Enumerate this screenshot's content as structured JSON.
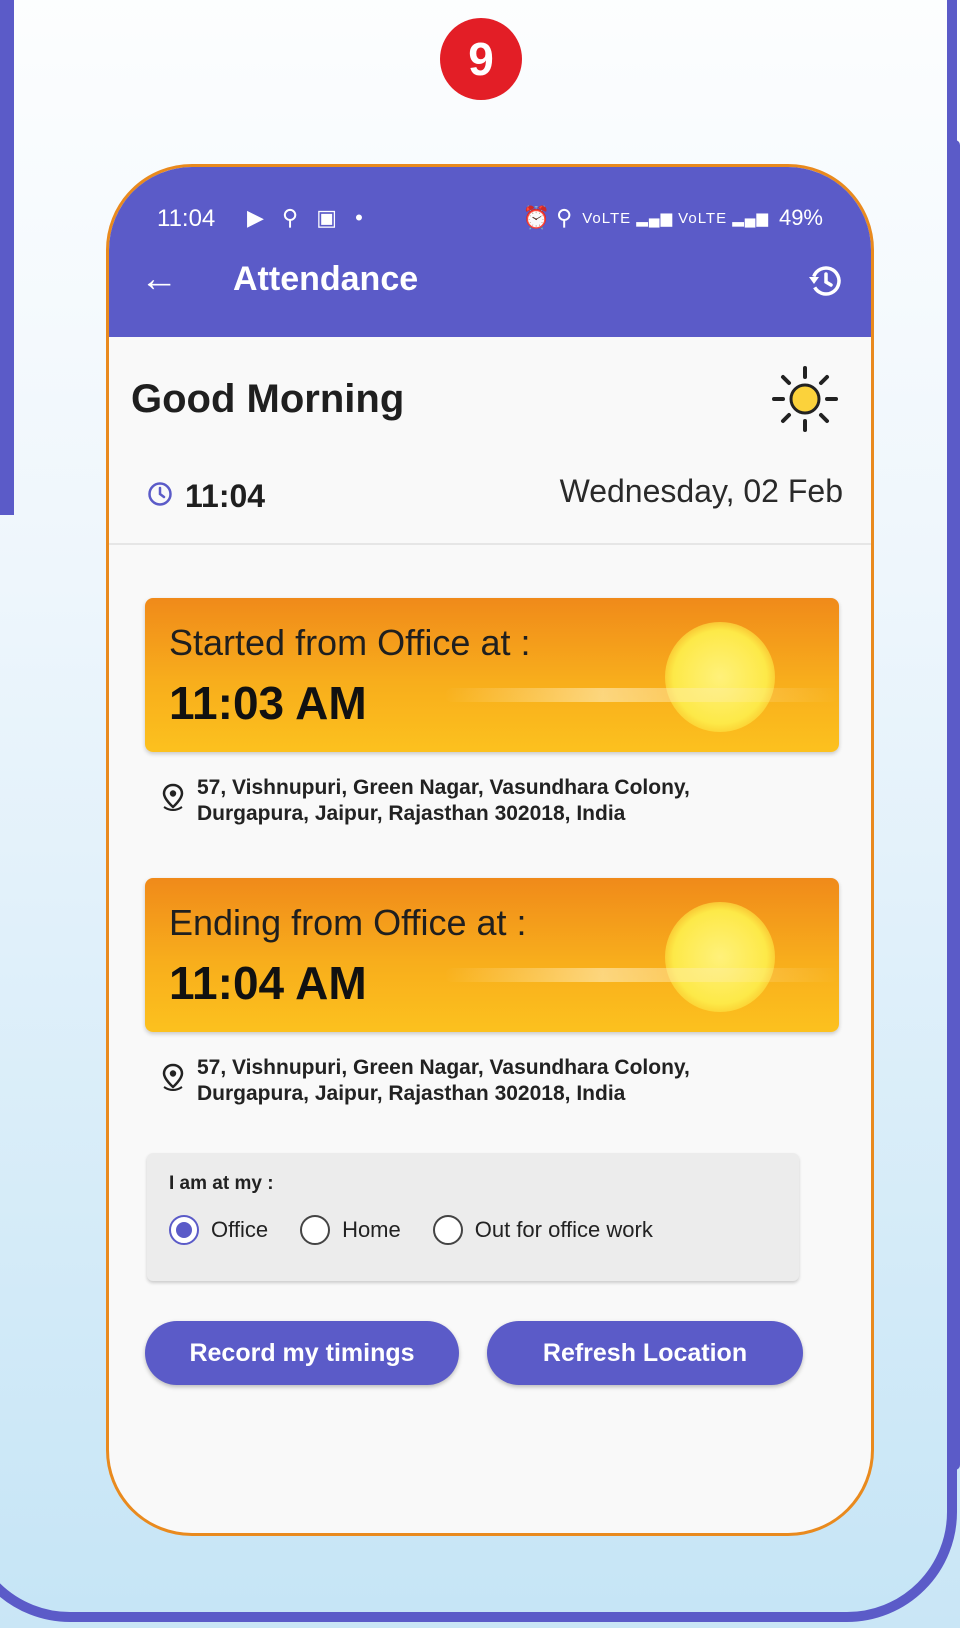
{
  "step_badge": "9",
  "status_bar": {
    "time": "11:04",
    "left_icons": "▶ ⚲ ▣ •",
    "right_icons": "⏰ ⚲",
    "signal": "VoLTE ▂▄▆ VoLTE ▂▄▆",
    "battery": "49%"
  },
  "appbar": {
    "title": "Attendance",
    "back_icon": "arrow-left-icon",
    "history_icon": "history-icon"
  },
  "greeting": {
    "text": "Good Morning",
    "weather_icon": "sun-icon"
  },
  "clock": {
    "time": "11:04",
    "date": "Wednesday, 02 Feb"
  },
  "start_card": {
    "label": "Started from Office at :",
    "time": "11:03 AM",
    "address": "57, Vishnupuri, Green Nagar, Vasundhara Colony, Durgapura, Jaipur, Rajasthan 302018, India"
  },
  "end_card": {
    "label": "Ending from Office at :",
    "time": "11:04 AM",
    "address": "57, Vishnupuri, Green Nagar, Vasundhara Colony, Durgapura, Jaipur, Rajasthan 302018, India"
  },
  "location_choice": {
    "title": "I am at my :",
    "options": [
      {
        "label": "Office",
        "checked": true
      },
      {
        "label": "Home",
        "checked": false
      },
      {
        "label": "Out for office work",
        "checked": false
      }
    ]
  },
  "buttons": {
    "record": "Record my timings",
    "refresh": "Refresh Location"
  },
  "colors": {
    "primary": "#5b5bc8",
    "badge": "#e31e26",
    "card_orange": "#f08a1a",
    "card_yellow": "#fcc11e",
    "phone_border": "#e98a1e"
  }
}
